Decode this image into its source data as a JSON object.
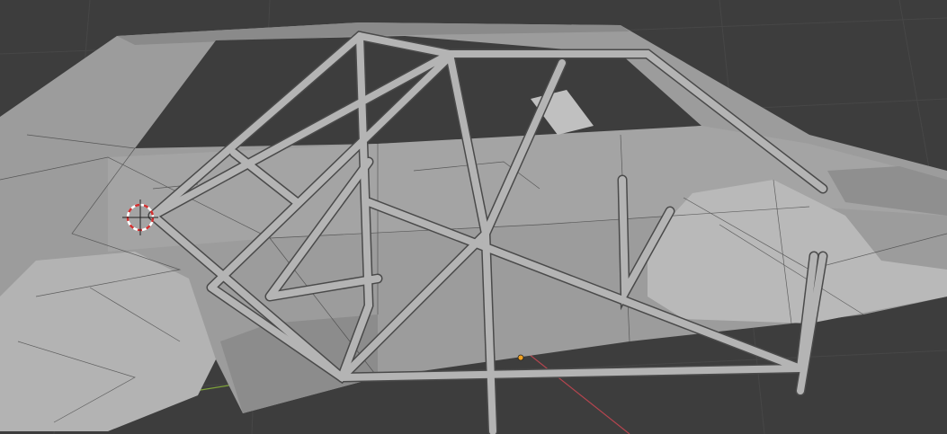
{
  "viewport": {
    "background_color": "#3d3d3d",
    "grid_color": "#474747",
    "x_axis_color": "#b5454f",
    "y_axis_color": "#7ea33a",
    "mesh_color": "#a9a9a9",
    "mesh_shadow_color": "#6e6e6e",
    "wire_color": "#3a3a3a",
    "tube_color": "#b4b4b4",
    "origin_color": "#f0a020",
    "cursor_color": "#d03030"
  }
}
